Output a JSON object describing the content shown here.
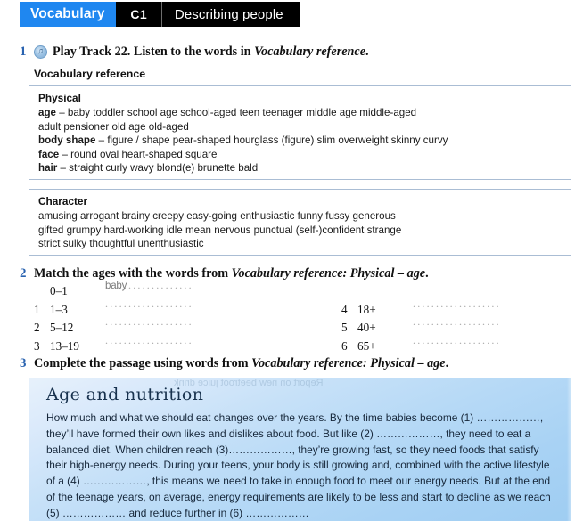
{
  "header": {
    "section_label": "Vocabulary",
    "level_label": "C1",
    "topic_label": "Describing people",
    "accent_color": "#1f87f0",
    "bar_color": "#000000"
  },
  "exercise1": {
    "number": "1",
    "audio_icon": "audio-disc-icon",
    "instruction_before": "Play Track 22. Listen to the words in ",
    "instruction_italic": "Vocabulary reference",
    "instruction_after": ".",
    "subheading": "Vocabulary reference"
  },
  "reference_boxes": [
    {
      "title": "Physical",
      "lines": [
        {
          "label": "age",
          "dash": " – ",
          "words": "baby   toddler   school age   school-aged   teen   teenager   middle age   middle-aged"
        },
        {
          "label": "",
          "dash": "",
          "words": "adult   pensioner   old age   old-aged"
        },
        {
          "label": "body shape",
          "dash": " – ",
          "words": "figure / shape   pear-shaped   hourglass (figure)   slim   overweight   skinny   curvy"
        },
        {
          "label": "face",
          "dash": " – ",
          "words": "round   oval   heart-shaped   square"
        },
        {
          "label": "hair",
          "dash": " – ",
          "words": "straight   curly   wavy   blond(e)   brunette   bald"
        }
      ]
    },
    {
      "title": "Character",
      "lines": [
        {
          "label": "",
          "dash": "",
          "words": "amusing   arrogant   brainy   creepy   easy-going   enthusiastic   funny   fussy   generous"
        },
        {
          "label": "",
          "dash": "",
          "words": "gifted   grumpy   hard-working   idle   mean   nervous   punctual   (self-)confident   strange"
        },
        {
          "label": "",
          "dash": "",
          "words": "strict   sulky   thoughtful   unenthusiastic"
        }
      ]
    }
  ],
  "exercise2": {
    "number": "2",
    "instruction_before": "Match the ages with the words from ",
    "instruction_italic": "Vocabulary reference: Physical – age",
    "instruction_after": ".",
    "left_rows": [
      {
        "index": "",
        "age": "0–1",
        "answer": "baby",
        "dots": "..................."
      },
      {
        "index": "1",
        "age": "1–3",
        "answer": "",
        "dots": "..................."
      },
      {
        "index": "2",
        "age": "5–12",
        "answer": "",
        "dots": "..................."
      },
      {
        "index": "3",
        "age": "13–19",
        "answer": "",
        "dots": "..................."
      }
    ],
    "right_rows": [
      {
        "index": "4",
        "age": "18+",
        "answer": "",
        "dots": "..................."
      },
      {
        "index": "5",
        "age": "40+",
        "answer": "",
        "dots": "..................."
      },
      {
        "index": "6",
        "age": "65+",
        "answer": "",
        "dots": "..................."
      }
    ]
  },
  "exercise3": {
    "number": "3",
    "instruction_before": "Complete the passage using words from ",
    "instruction_italic": "Vocabulary reference: Physical – age",
    "instruction_after": ".",
    "passage": {
      "title": "Age and nutrition",
      "ghost_text": "Report on new beetroot juice drink",
      "background_color": "#b6d9f6",
      "text": "How much and what we should eat changes over the years. By the time babies become (1) ………………, they’ll have formed their own likes and dislikes about food. But like (2) ………………, they need to eat a balanced diet. When children reach (3)………………, they’re growing fast, so they need foods that satisfy their high-energy needs. During your teens, your body is still growing and, combined with the active lifestyle of a (4) ………………, this means we need to take in enough food to meet our energy needs. But at the end of the teenage years, on average, energy requirements are likely to be less and start to decline as we reach (5) ……………… and reduce further in (6) ………………"
    }
  }
}
